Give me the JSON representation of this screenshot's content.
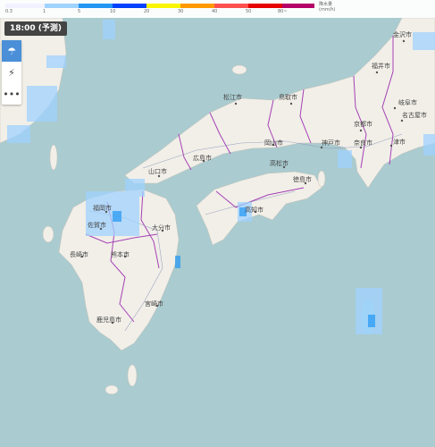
{
  "legend": {
    "ticks": [
      "0.3",
      "1",
      "5",
      "10",
      "20",
      "30",
      "40",
      "50",
      "80~"
    ],
    "unit_line1": "降水量",
    "unit_line2": "(mm/h)",
    "colors": [
      "#f2f2ff",
      "#a0d2ff",
      "#2196f3",
      "#0041ff",
      "#faf500",
      "#ff9900",
      "#ff5050",
      "#e60000",
      "#b40068"
    ]
  },
  "time_label": "18:00 (予測)",
  "tools": [
    {
      "icon": "rain-cloud-icon",
      "active": true
    },
    {
      "icon": "lightning-icon",
      "active": false
    },
    {
      "icon": "more-dots-icon",
      "active": false
    }
  ],
  "cities": [
    "金沢市",
    "福井市",
    "松江市",
    "鳥取市",
    "岐阜市",
    "名古屋市",
    "京都市",
    "津市",
    "岡山市",
    "神戸市",
    "奈良市",
    "広島市",
    "高松市",
    "山口市",
    "徳島市",
    "福岡市",
    "佐賀市",
    "高知市",
    "大分市",
    "長崎市",
    "熊本市",
    "宮崎市",
    "鹿児島市"
  ]
}
